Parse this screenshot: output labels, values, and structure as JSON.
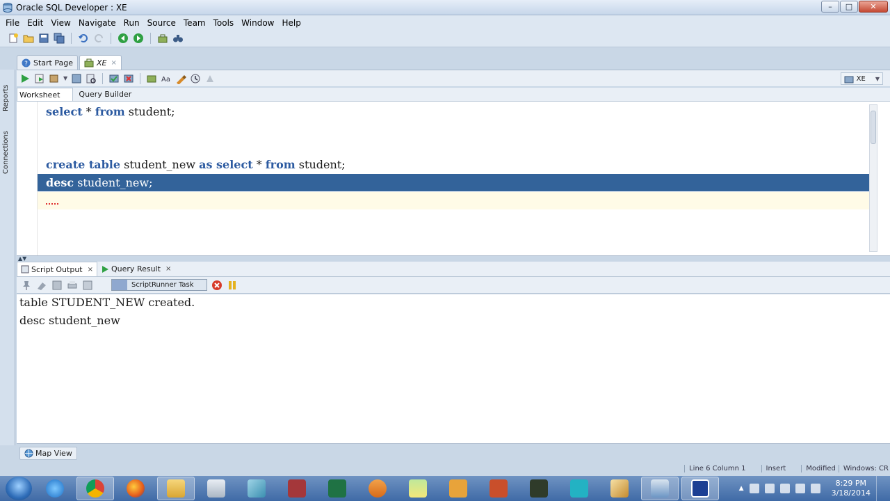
{
  "window": {
    "title": "Oracle SQL Developer : XE",
    "min": "–",
    "max": "□",
    "close": "✕"
  },
  "menu": [
    "File",
    "Edit",
    "View",
    "Navigate",
    "Run",
    "Source",
    "Team",
    "Tools",
    "Window",
    "Help"
  ],
  "side_tabs": {
    "reports": "Reports",
    "connections": "Connections"
  },
  "doc_tabs": [
    {
      "label": "Start Page"
    },
    {
      "label": "XE",
      "close": "×"
    }
  ],
  "connection": {
    "label": "XE"
  },
  "sub_tabs": {
    "worksheet": "Worksheet",
    "query_builder": "Query Builder"
  },
  "editor": {
    "lines": [
      {
        "kw1": "select",
        "t1": " * ",
        "kw2": "from",
        "t2": " student;"
      },
      {
        "kw1": "create table",
        "t1": " student_new ",
        "kw2": "as select",
        "t2": " * ",
        "kw3": "from",
        "t3": " student;"
      },
      {
        "kw1": "desc",
        "t1": " student_new;"
      }
    ]
  },
  "output_tabs": {
    "script_output": "Script Output",
    "query_result": "Query Result",
    "close": "×"
  },
  "task": {
    "label": "ScriptRunner Task"
  },
  "output": {
    "lines": [
      "table STUDENT_NEW created.",
      "desc student_new"
    ]
  },
  "map_view": {
    "label": "Map View"
  },
  "status": {
    "position": "Line 6 Column 1",
    "mode": "Insert",
    "modified": "Modified",
    "os": "Windows: CR"
  },
  "clock": {
    "time": "8:29 PM",
    "date": "3/18/2014"
  },
  "colors": {
    "keyword": "#2d5ba1",
    "selection": "#33639a",
    "taskbar": "#3f6aa6"
  }
}
